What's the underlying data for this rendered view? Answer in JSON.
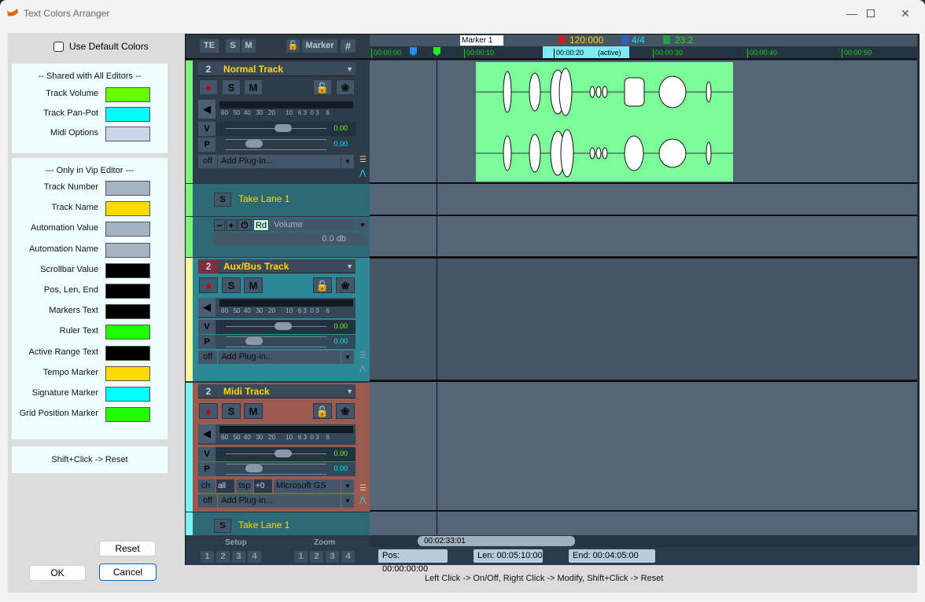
{
  "window": {
    "title": "Text Colors Arranger",
    "minimize_icon": "minimize-icon",
    "maximize_icon": "maximize-icon",
    "close_icon": "close-icon"
  },
  "left_panel": {
    "use_default_label": "Use Default Colors",
    "use_default_checked": false,
    "shared_group": {
      "title": "--  Shared with All Editors  --",
      "items": [
        {
          "label": "Track Volume",
          "color": "#66ff00"
        },
        {
          "label": "Track Pan-Pot",
          "color": "#00ffff"
        },
        {
          "label": "Midi Options",
          "color": "#c8d8e6"
        }
      ]
    },
    "vip_group": {
      "title": "---  Only in Vip Editor  ---",
      "items": [
        {
          "label": "Track Number",
          "color": "#a4b4c4"
        },
        {
          "label": "Track Name",
          "color": "#ffd800"
        },
        {
          "label": "Automation Value",
          "color": "#a4b4c4"
        },
        {
          "label": "Automation Name",
          "color": "#a4b4c4"
        },
        {
          "label": "Scrollbar Value",
          "color": "#000000"
        },
        {
          "label": "Pos, Len, End",
          "color": "#000000"
        },
        {
          "label": "Markers Text",
          "color": "#000000"
        },
        {
          "label": "Ruler Text",
          "color": "#22ff00"
        },
        {
          "label": "Active Range Text",
          "color": "#000000"
        },
        {
          "label": "Tempo Marker",
          "color": "#ffd800"
        },
        {
          "label": "Signature Marker",
          "color": "#00ffff"
        },
        {
          "label": "Grid Position Marker",
          "color": "#22ff00"
        }
      ]
    },
    "hint": "Shift+Click -> Reset",
    "reset_label": "Reset",
    "ok_label": "OK",
    "cancel_label": "Cancel"
  },
  "daw": {
    "toolbar": {
      "te": "TE",
      "s": "S",
      "m": "M",
      "lock_icon": "lock-icon",
      "marker": "Marker",
      "grid_icon": "grid-icon"
    },
    "markers": {
      "marker_name": "Marker 1",
      "tempo": "120:000",
      "signature": "4/4",
      "grid": "23:2"
    },
    "ruler": {
      "ticks": [
        "00:00:00",
        "00:00:10",
        "00:00:20",
        "00:00:30",
        "00:00:40",
        "00:00:50"
      ],
      "active_label": "(active)"
    },
    "tracks": [
      {
        "number": "2",
        "name": "Normal Track",
        "rec": "●",
        "solo": "S",
        "mute": "M",
        "meter_scale": "60   50  40   30   20      10   6 3  0 3    6",
        "vol_label": "V",
        "vol_value": "0.00",
        "pan_label": "P",
        "pan_value": "0.00",
        "off_label": "off",
        "plugin": "Add Plug-in...",
        "take_lane": {
          "solo": "S",
          "name": "Take Lane 1"
        },
        "automation": {
          "minus": "−",
          "plus": "+",
          "power": "⏻",
          "read": "Rd",
          "param": "Volume",
          "value": "0.0 db"
        }
      },
      {
        "number": "2",
        "name": "Aux/Bus Track",
        "rec": "●",
        "solo": "S",
        "mute": "M",
        "meter_scale": "60   50  40   30   20      10   6 3  0 3    6",
        "vol_label": "V",
        "vol_value": "0.00",
        "pan_label": "P",
        "pan_value": "0.00",
        "off_label": "off",
        "plugin": "Add Plug-in..."
      },
      {
        "number": "2",
        "name": "Midi Track",
        "rec": "●",
        "solo": "S",
        "mute": "M",
        "meter_scale": "60   50  40   30   20      10   6 3  0 3    6",
        "vol_label": "V",
        "vol_value": "0.00",
        "pan_label": "P",
        "pan_value": "0.00",
        "ch_label": "ch.",
        "ch_value": "all",
        "tsp_label": "tsp",
        "tsp_value": "+0",
        "instrument": "Microsoft GS",
        "off_label": "off",
        "plugin": "Add Plug-in...",
        "take_lane": {
          "solo": "S",
          "name": "Take Lane 1"
        }
      }
    ],
    "bottom": {
      "setup_label": "Setup",
      "zoom_label": "Zoom",
      "setup_buttons": [
        "1",
        "2",
        "3",
        "4"
      ],
      "zoom_buttons": [
        "1",
        "2",
        "3",
        "4"
      ],
      "scroll_value": "00:02:33:01",
      "pos": "Pos:  00:00:00:00",
      "len": "Len:  00:05:10:00",
      "end": "End:  00:04:05:00"
    }
  },
  "footer_hint": "Left Click -> On/Off,  Right Click -> Modify,  Shift+Click -> Reset"
}
